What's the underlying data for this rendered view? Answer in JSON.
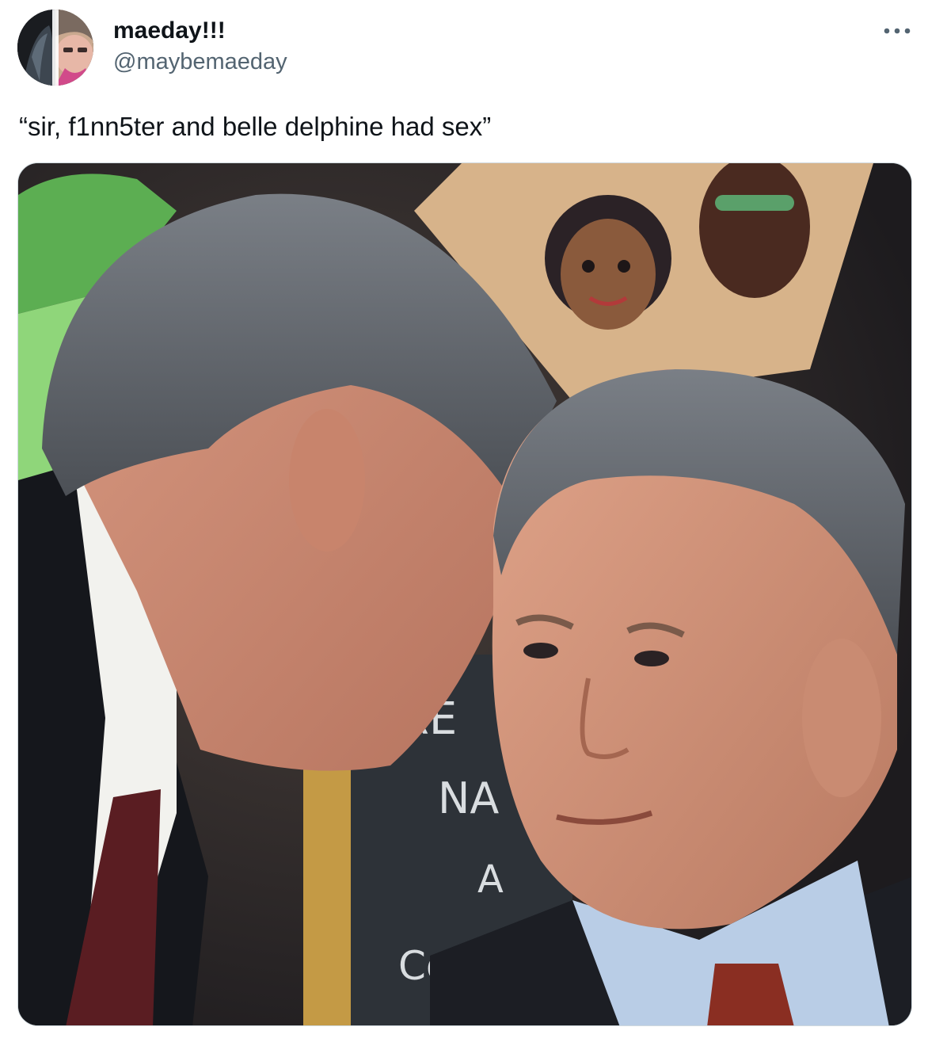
{
  "tweet": {
    "display_name": "maeday!!!",
    "handle": "@maybemaeday",
    "text": "“sir, f1nn5ter and belle delphine had sex”",
    "more_icon": "more-horizontal-icon"
  },
  "media": {
    "chalkboard_text": [
      "RE",
      "NA",
      "A",
      "Co"
    ]
  },
  "colors": {
    "text_primary": "#0f1419",
    "text_secondary": "#536471",
    "border": "#cfd9de"
  }
}
